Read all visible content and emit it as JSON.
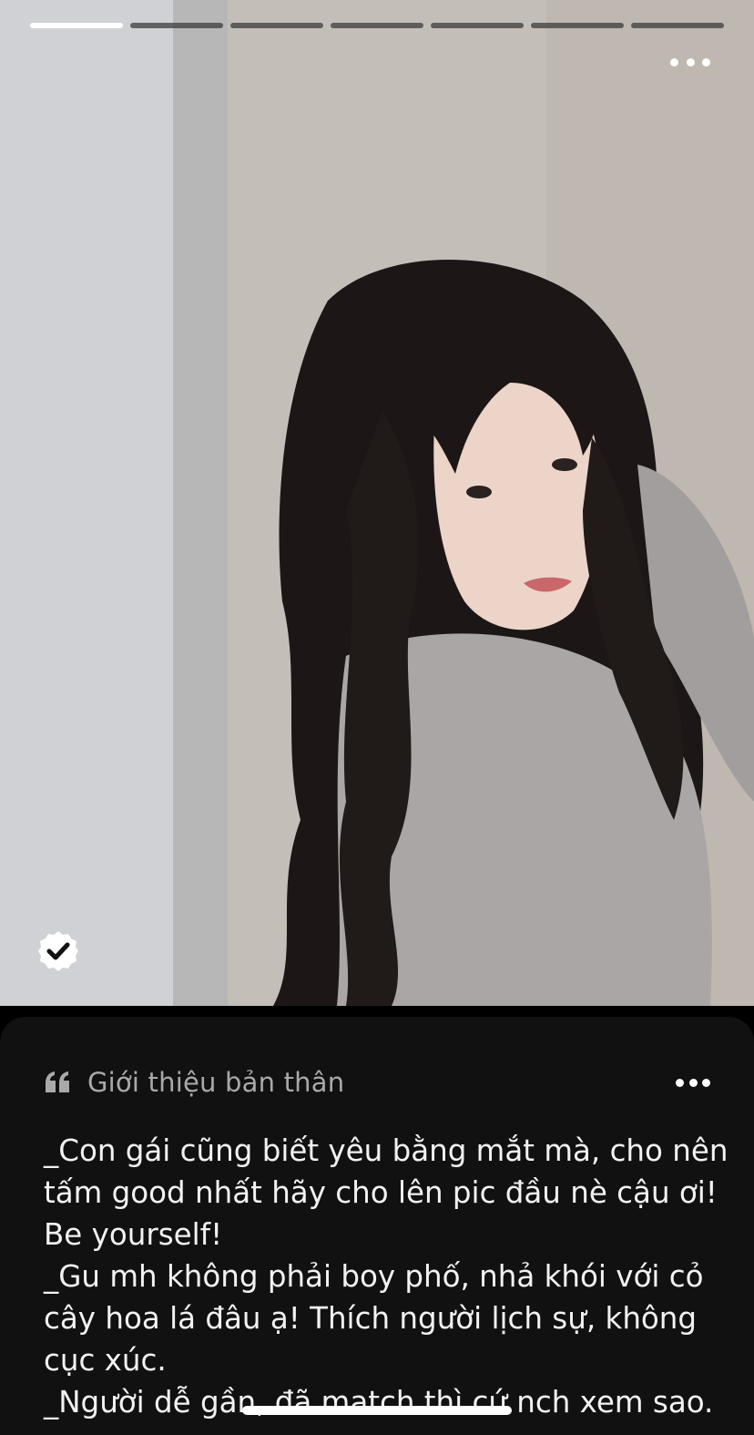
{
  "photo": {
    "total_photos": 7,
    "current_photo": 1,
    "more_icon": "ellipsis-icon",
    "verified_icon": "verified-check-badge-icon"
  },
  "profile_card": {
    "quote_icon": "quote-icon",
    "section_title": "Giới thiệu bản thân",
    "more_icon": "ellipsis-icon",
    "bio_lines": [
      "_Con gái cũng biết yêu bằng mắt mà, cho nên",
      "tấm good nhất hãy cho lên pic đầu nè cậu ơi!",
      "Be yourself!",
      "_Gu mh không phải boy phố, nhả khói với cỏ",
      "cây hoa lá đâu ạ! Thích người lịch sự, không",
      "cục xúc.",
      "_Người dễ gần, đã match thì cứ nch xem sao."
    ]
  },
  "colors": {
    "card_background": "#111111",
    "title_gray": "#a9a9a9",
    "bio_text": "#f2f2f2",
    "progress_active": "#ffffff"
  }
}
